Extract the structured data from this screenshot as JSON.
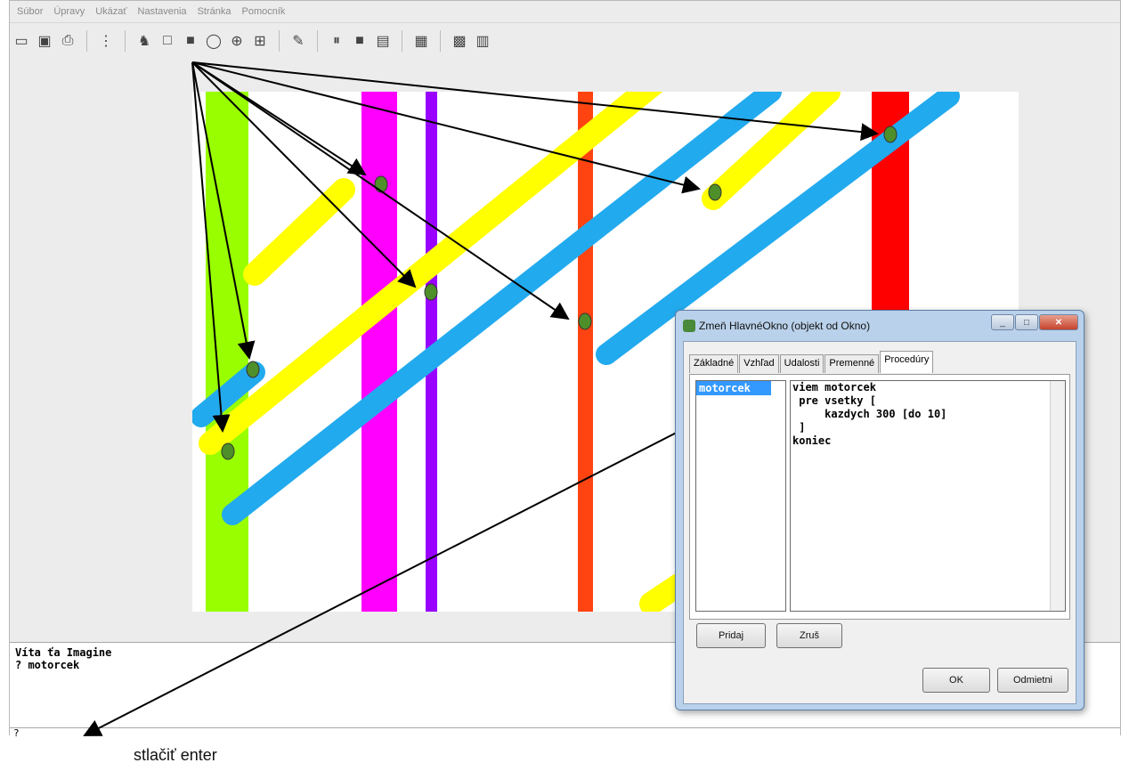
{
  "menu": [
    "Súbor",
    "Úpravy",
    "Ukázať",
    "Nastavenia",
    "Stránka",
    "Pomocník"
  ],
  "toolbar": {
    "icons": [
      "open-folder-icon",
      "save-icon",
      "print-icon",
      "tree-icon",
      "turtle-icon",
      "rectangle-icon",
      "filled-rectangle-icon",
      "circle-icon",
      "target-icon",
      "slider-icon",
      "turtle-settings-icon",
      "pause-icon",
      "stop-icon",
      "step-icon",
      "window-icon",
      "layout-icon",
      "layout2-icon"
    ]
  },
  "console": {
    "line1": "Víta ťa Imagine",
    "line2": "? motorcek",
    "prompt": "?"
  },
  "annotation": {
    "caption": "stlačiť enter"
  },
  "colors": {
    "green": "#99ff00",
    "magenta": "#ff00ff",
    "purple": "#9900ff",
    "orange": "#ff4411",
    "red": "#ff0000",
    "yellow": "#ffff00",
    "blue": "#22aaee"
  },
  "dialog": {
    "title": "Zmeň HlavnéOkno (objekt od Okno)",
    "tabs": [
      "Základné",
      "Vzhľad",
      "Udalosti",
      "Premenné",
      "Procedúry"
    ],
    "active_tab": "Procedúry",
    "procedures": [
      "motorcek"
    ],
    "code": [
      "viem motorcek",
      " pre vsetky [",
      "     kazdych 300 [do 10]",
      " ]",
      "koniec"
    ],
    "buttons": {
      "add": "Pridaj",
      "remove": "Zruš",
      "ok": "OK",
      "cancel": "Odmietni"
    }
  }
}
